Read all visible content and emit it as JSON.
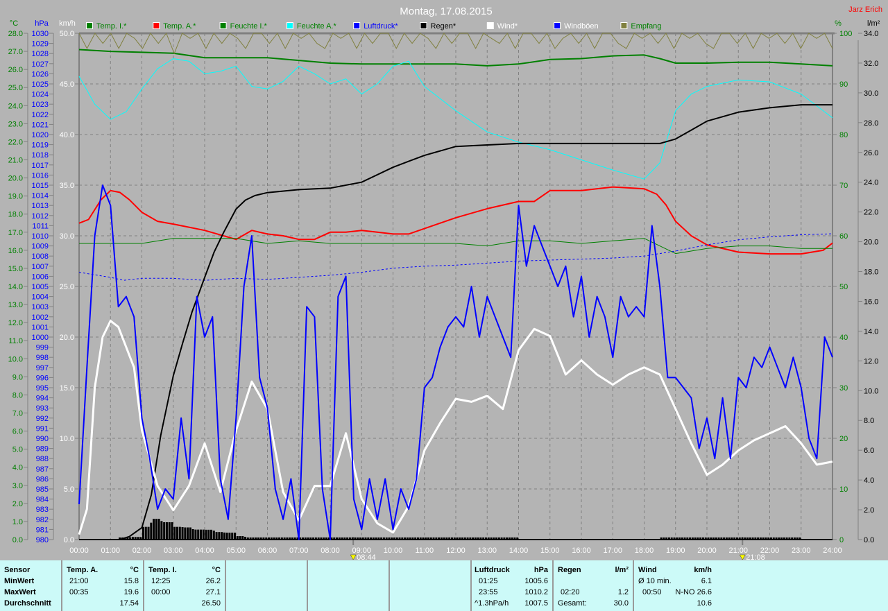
{
  "title": "Montag, 17.08.2015",
  "author": "Jarz Erich",
  "legend": [
    {
      "label": "Temp. I.*",
      "color": "#008000",
      "text_color": "#008000"
    },
    {
      "label": "Temp. A.*",
      "color": "#ff0000",
      "text_color": "#008000"
    },
    {
      "label": "Feuchte I.*",
      "color": "#008000",
      "text_color": "#008000"
    },
    {
      "label": "Feuchte A.*",
      "color": "#00ffff",
      "text_color": "#008000"
    },
    {
      "label": "Luftdruck*",
      "color": "#0000ff",
      "text_color": "#0000ff"
    },
    {
      "label": "Regen*",
      "color": "#000000",
      "text_color": "#000000"
    },
    {
      "label": "Wind*",
      "color": "#ffffff",
      "text_color": "#ffffff"
    },
    {
      "label": "Windböen",
      "color": "#0000ff",
      "text_color": "#ffffff"
    },
    {
      "label": "Empfang",
      "color": "#808040",
      "text_color": "#008000"
    }
  ],
  "chart_data": {
    "type": "line",
    "title": "Montag, 17.08.2015",
    "x_range_hours": [
      0,
      24
    ],
    "x_ticks": [
      "00:00",
      "01:00",
      "02:00",
      "03:00",
      "04:00",
      "05:00",
      "06:00",
      "07:00",
      "08:00",
      "09:00",
      "10:00",
      "11:00",
      "12:00",
      "13:00",
      "14:00",
      "15:00",
      "16:00",
      "17:00",
      "18:00",
      "19:00",
      "20:00",
      "21:00",
      "22:00",
      "23:00",
      "24:00"
    ],
    "axes": {
      "temp": {
        "unit": "°C",
        "range": [
          0,
          28
        ],
        "step": 1,
        "color": "#008000"
      },
      "pressure": {
        "unit": "hPa",
        "range": [
          980,
          1030
        ],
        "step": 1,
        "color": "#0000ff"
      },
      "wind": {
        "unit": "km/h",
        "range": [
          0,
          50
        ],
        "step": 5,
        "color": "#ffffff"
      },
      "humidity": {
        "unit": "%",
        "range": [
          0,
          100
        ],
        "step": 10,
        "color": "#008000"
      },
      "rain": {
        "unit": "l/m²",
        "range": [
          0,
          34
        ],
        "step": 2,
        "color": "#000000"
      }
    },
    "grid": true,
    "markers": [
      {
        "label": "08:44",
        "hour": 8.733
      },
      {
        "label": "21:08",
        "hour": 21.133
      }
    ],
    "series": [
      {
        "name": "Temp. I.*",
        "axis": "temp",
        "color": "#008000",
        "width": 2,
        "x": [
          0,
          1,
          2,
          3,
          4,
          5,
          6,
          7,
          8,
          9,
          10,
          11,
          12,
          13,
          14,
          15,
          16,
          17,
          18,
          18.5,
          19,
          20,
          21,
          22,
          23,
          24
        ],
        "y": [
          27.1,
          27.0,
          26.95,
          26.9,
          26.65,
          26.65,
          26.65,
          26.5,
          26.35,
          26.3,
          26.3,
          26.3,
          26.3,
          26.2,
          26.3,
          26.55,
          26.6,
          26.75,
          26.8,
          26.6,
          26.35,
          26.35,
          26.4,
          26.4,
          26.3,
          26.2
        ]
      },
      {
        "name": "Temp. A.*",
        "axis": "temp",
        "color": "#ff0000",
        "width": 2,
        "x": [
          0,
          0.3,
          0.7,
          1,
          1.3,
          1.6,
          2,
          2.5,
          3,
          4,
          5,
          5.5,
          6,
          6.5,
          7,
          7.5,
          8,
          8.5,
          9,
          9.5,
          10,
          10.5,
          11,
          12,
          13,
          14,
          14.5,
          15,
          16,
          17,
          18,
          18.4,
          18.7,
          19,
          19.5,
          20,
          21,
          22,
          23,
          23.7,
          24
        ],
        "y": [
          17.5,
          17.7,
          18.8,
          19.3,
          19.2,
          18.8,
          18.1,
          17.6,
          17.45,
          17.1,
          16.6,
          17.1,
          16.9,
          16.8,
          16.6,
          16.6,
          17.0,
          17.0,
          17.1,
          17.0,
          16.9,
          16.9,
          17.2,
          17.8,
          18.3,
          18.7,
          18.7,
          19.3,
          19.3,
          19.5,
          19.4,
          19.1,
          18.5,
          17.6,
          16.8,
          16.3,
          15.9,
          15.8,
          15.8,
          16.0,
          16.4
        ]
      },
      {
        "name": "Feuchte I.*",
        "axis": "humidity",
        "color": "#008000",
        "width": 1,
        "x": [
          0,
          1,
          2,
          3,
          4,
          5,
          6,
          7,
          8,
          9,
          10,
          11,
          12,
          13,
          14,
          15,
          16,
          17,
          18,
          19,
          20,
          21,
          22,
          23,
          24
        ],
        "y": [
          58.5,
          58.5,
          58.5,
          59.5,
          59.5,
          59.5,
          58.5,
          59,
          58.5,
          58.5,
          58.5,
          58.5,
          58.5,
          58,
          59,
          59,
          58.5,
          59,
          59.5,
          56.5,
          57.5,
          58,
          58,
          57.5,
          57.5
        ]
      },
      {
        "name": "Feuchte A.*",
        "axis": "humidity",
        "color": "#00ffff",
        "width": 1,
        "x": [
          0,
          0.5,
          1,
          1.5,
          2,
          2.5,
          3,
          3.5,
          4,
          4.5,
          5,
          5.5,
          6,
          6.5,
          7,
          7.5,
          8,
          8.5,
          9,
          9.5,
          10,
          10.5,
          11,
          12,
          13,
          14,
          15,
          16,
          17,
          18,
          18.5,
          19,
          19.5,
          20,
          21,
          22,
          23,
          24
        ],
        "y": [
          91.5,
          86,
          83,
          84.5,
          89,
          93,
          95,
          94.5,
          92,
          92.5,
          93.5,
          89.5,
          89,
          90.5,
          93.5,
          92,
          90,
          91,
          88,
          90,
          93.5,
          94.5,
          89.5,
          84.7,
          80.5,
          78.5,
          77,
          75,
          73,
          71.2,
          74.4,
          84.7,
          88,
          89.5,
          90.8,
          90.4,
          88,
          83.3
        ]
      },
      {
        "name": "Luftdruck*",
        "axis": "pressure",
        "color": "#0000ff",
        "width": 1,
        "dashed": true,
        "x": [
          0,
          1,
          1.42,
          2,
          3,
          4,
          5,
          6,
          7,
          8,
          9,
          10,
          11,
          12,
          13,
          14,
          15,
          16,
          17,
          18,
          19,
          20,
          21,
          22,
          23,
          24
        ],
        "y": [
          1006.4,
          1005.9,
          1005.6,
          1005.8,
          1005.8,
          1005.6,
          1005.8,
          1005.7,
          1005.9,
          1006.1,
          1006.4,
          1006.8,
          1007.0,
          1007.1,
          1007.3,
          1007.5,
          1007.6,
          1007.7,
          1007.8,
          1008.0,
          1008.5,
          1009.1,
          1009.6,
          1009.9,
          1010.1,
          1010.2
        ]
      },
      {
        "name": "Regen*",
        "axis": "rain",
        "color": "#000000",
        "width": 2,
        "x": [
          0,
          1.3,
          1.6,
          2,
          2.3,
          2.6,
          3,
          3.3,
          3.6,
          4,
          4.3,
          4.6,
          5,
          5.3,
          5.6,
          6,
          7,
          8,
          9,
          10,
          10.5,
          11,
          12,
          13,
          14,
          15,
          16,
          17,
          18,
          18.5,
          19,
          19.5,
          20,
          21,
          22,
          23,
          24
        ],
        "y": [
          0,
          0,
          0.2,
          0.8,
          3,
          7,
          11,
          13.2,
          15.3,
          17.6,
          19.3,
          20.6,
          22.2,
          22.8,
          23.1,
          23.3,
          23.5,
          23.6,
          24,
          25,
          25.4,
          25.8,
          26.4,
          26.5,
          26.6,
          26.6,
          26.6,
          26.6,
          26.6,
          26.6,
          26.9,
          27.5,
          28.1,
          28.7,
          29,
          29.2,
          29.2
        ]
      },
      {
        "name": "Wind*",
        "axis": "wind",
        "color": "#ffffff",
        "width": 3,
        "x": [
          0,
          0.25,
          0.5,
          0.75,
          1,
          1.25,
          1.5,
          1.75,
          2,
          2.5,
          3,
          3.5,
          4,
          4.5,
          5,
          5.5,
          6,
          6.5,
          7,
          7.5,
          8,
          8.5,
          9,
          9.5,
          10,
          10.5,
          11,
          11.5,
          12,
          12.5,
          13,
          13.5,
          14,
          14.5,
          15,
          15.5,
          16,
          16.5,
          17,
          17.5,
          18,
          18.5,
          19,
          19.5,
          20,
          20.5,
          21,
          21.5,
          22,
          22.5,
          23,
          23.5,
          24
        ],
        "y": [
          0.5,
          3,
          15,
          20,
          21.6,
          21,
          19,
          17,
          10.8,
          5.3,
          2.9,
          5.3,
          9.5,
          4.7,
          10.8,
          15.6,
          12.9,
          4.7,
          1.9,
          5.3,
          5.3,
          10.5,
          4,
          1.6,
          0.7,
          3.3,
          8.8,
          11.5,
          13.9,
          13.6,
          14.2,
          12.9,
          18.7,
          20.8,
          20.1,
          16.3,
          17.7,
          16.3,
          15.3,
          16.3,
          17,
          16.3,
          12.9,
          9.5,
          6.4,
          7.4,
          8.8,
          9.8,
          10.5,
          11.2,
          9.5,
          7.4,
          7.7
        ]
      },
      {
        "name": "Windböen",
        "axis": "wind",
        "color": "#0000ff",
        "width": 2,
        "x": [
          0,
          0.25,
          0.5,
          0.75,
          1,
          1.25,
          1.5,
          1.75,
          2,
          2.25,
          2.5,
          2.75,
          3,
          3.25,
          3.5,
          3.75,
          4,
          4.25,
          4.5,
          4.75,
          5,
          5.25,
          5.5,
          5.75,
          6,
          6.25,
          6.5,
          6.75,
          7,
          7.25,
          7.5,
          7.75,
          8,
          8.25,
          8.5,
          8.75,
          9,
          9.25,
          9.5,
          9.75,
          10,
          10.25,
          10.5,
          10.75,
          11,
          11.25,
          11.5,
          11.75,
          12,
          12.25,
          12.5,
          12.75,
          13,
          13.25,
          13.5,
          13.75,
          14,
          14.25,
          14.5,
          14.75,
          15,
          15.25,
          15.5,
          15.75,
          16,
          16.25,
          16.5,
          16.75,
          17,
          17.25,
          17.5,
          17.75,
          18,
          18.25,
          18.5,
          18.75,
          19,
          19.25,
          19.5,
          19.75,
          20,
          20.25,
          20.5,
          20.75,
          21,
          21.25,
          21.5,
          21.75,
          22,
          22.25,
          22.5,
          22.75,
          23,
          23.25,
          23.5,
          23.75,
          24
        ],
        "y": [
          3.5,
          17,
          30,
          35,
          33,
          23,
          24,
          22,
          12,
          8,
          3,
          5,
          4,
          12,
          6,
          24,
          20,
          22,
          6,
          2,
          12,
          25,
          30,
          16,
          13,
          5,
          2,
          6,
          0,
          23,
          22,
          5,
          0,
          24,
          26,
          4,
          1,
          6,
          2,
          6,
          1,
          5,
          3,
          6,
          15,
          16,
          19,
          21,
          22,
          21,
          25,
          20,
          24,
          22,
          20,
          18,
          33,
          27,
          31,
          29,
          27,
          25,
          27,
          22,
          26,
          20,
          24,
          22,
          18,
          24,
          22,
          23,
          22,
          31,
          25,
          16,
          16,
          15,
          14,
          9,
          12,
          8,
          14,
          8,
          16,
          15,
          18,
          17,
          19,
          17,
          15,
          18,
          15,
          10,
          8,
          20,
          18
        ]
      },
      {
        "name": "Empfang",
        "axis": "humidity",
        "color": "#808040",
        "width": 1,
        "y": [
          100,
          97,
          100,
          98,
          100,
          97,
          100,
          99,
          97,
          100,
          98,
          100,
          96,
          100,
          99,
          100,
          97,
          100,
          98,
          100,
          99,
          97,
          100,
          100,
          98,
          100,
          97,
          100,
          99,
          100,
          98,
          97,
          100,
          99,
          100,
          97,
          100,
          98,
          100,
          100,
          97,
          100,
          98,
          100,
          99,
          97,
          100,
          98,
          100,
          100,
          97,
          100,
          99,
          98,
          100,
          97,
          100,
          100,
          98,
          100,
          97,
          99,
          100,
          98,
          100,
          97,
          100,
          100,
          98,
          97,
          100,
          99,
          100,
          98,
          100,
          97,
          100,
          99,
          100,
          98,
          97,
          100,
          100,
          98,
          100,
          97,
          100,
          99,
          100,
          98,
          100,
          97,
          100,
          99,
          100,
          97
        ]
      }
    ]
  },
  "stats": {
    "sensor": {
      "header": "Sensor",
      "rows": [
        "MinWert",
        "MaxWert",
        "Durchschnitt"
      ]
    },
    "temp_a": {
      "header": "Temp. A.",
      "unit": "°C",
      "min_time": "21:00",
      "min": "15.8",
      "max_time": "00:35",
      "max": "19.6",
      "avg": "17.54"
    },
    "temp_i": {
      "header": "Temp. I.",
      "unit": "°C",
      "min_time": "12:25",
      "min": "26.2",
      "max_time": "00:00",
      "max": "27.1",
      "avg": "26.50"
    },
    "pressure": {
      "header": "Luftdruck",
      "unit": "hPa",
      "min_time": "01:25",
      "min": "1005.6",
      "max_time": "23:55",
      "max": "1010.2",
      "trend": "^1.3hPa/h",
      "avg": "1007.5"
    },
    "rain": {
      "header": "Regen",
      "unit": "l/m²",
      "max_time": "02:20",
      "max": "1.2",
      "total_label": "Gesamt:",
      "total": "30.0"
    },
    "wind": {
      "header": "Wind",
      "unit": "km/h",
      "avg10_label": "Ø 10 min.",
      "avg10": "6.1",
      "max_time": "00:50",
      "max": "N-NO 26.6",
      "avg": "10.6"
    }
  }
}
